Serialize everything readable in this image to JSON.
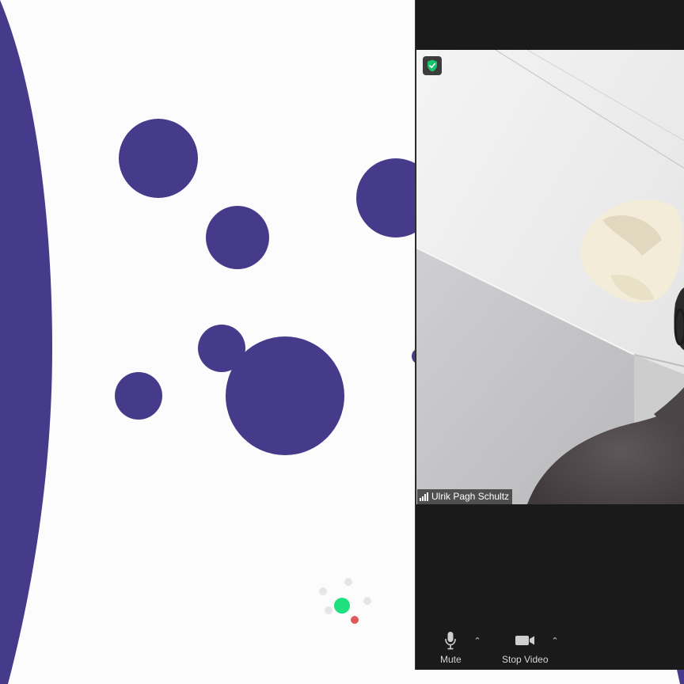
{
  "colors": {
    "slide_background": "#fcfcfd",
    "shape_purple": "#463b8a",
    "zoom_panel": "#1a1a1a",
    "secure_green": "#19c26b",
    "loader_green": "#1fe07f",
    "loader_red": "#e0585a",
    "loader_gray": "#e6e6e6"
  },
  "slide": {
    "shapes": [
      "large-arc",
      "circle",
      "circle",
      "circle",
      "circle",
      "circle",
      "circle",
      "circle"
    ]
  },
  "zoom": {
    "encryption_icon": "shield-check-icon",
    "participant": {
      "name": "Ulrik Pagh Schultz",
      "signal_icon": "signal-bars-icon"
    },
    "toolbar": {
      "mute_label": "Mute",
      "mute_icon": "microphone-icon",
      "stop_video_label": "Stop Video",
      "stop_video_icon": "video-camera-icon",
      "caret_icon": "caret-up-icon"
    }
  },
  "loading_indicator": "spinner-dots"
}
